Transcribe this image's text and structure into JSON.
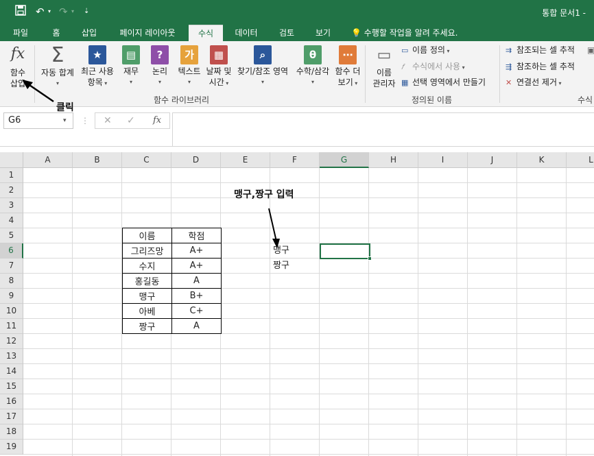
{
  "window": {
    "title": "통합 문서1 -"
  },
  "tabs": [
    {
      "label": "파일",
      "active": false
    },
    {
      "label": "홈",
      "active": false
    },
    {
      "label": "삽입",
      "active": false
    },
    {
      "label": "페이지 레이아웃",
      "active": false
    },
    {
      "label": "수식",
      "active": true
    },
    {
      "label": "데이터",
      "active": false
    },
    {
      "label": "검토",
      "active": false
    },
    {
      "label": "보기",
      "active": false
    }
  ],
  "tell_me": "수행할 작업을 알려 주세요.",
  "ribbon": {
    "insert_function": {
      "icon_text": "fx",
      "line1": "함수",
      "line2": "삽입"
    },
    "library": [
      {
        "line1": "자동 합계",
        "line2": "",
        "icon": "sigma-icon"
      },
      {
        "line1": "최근 사용",
        "line2": "항목",
        "icon": "star-book-icon"
      },
      {
        "line1": "재무",
        "line2": "",
        "icon": "finance-icon"
      },
      {
        "line1": "논리",
        "line2": "",
        "icon": "question-icon"
      },
      {
        "line1": "텍스트",
        "line2": "",
        "icon": "text-icon"
      },
      {
        "line1": "날짜 및",
        "line2": "시간",
        "icon": "calendar-icon"
      },
      {
        "line1": "찾기/참조 영역",
        "line2": "",
        "icon": "lookup-icon"
      },
      {
        "line1": "수학/삼각",
        "line2": "",
        "icon": "theta-icon"
      },
      {
        "line1": "함수 더",
        "line2": "보기",
        "icon": "more-functions-icon"
      }
    ],
    "library_group_label": "함수 라이브러리",
    "name_manager": {
      "line1": "이름",
      "line2": "관리자"
    },
    "defined_names": {
      "define": "이름 정의",
      "use_in_formula": "수식에서 사용",
      "create_from_selection": "선택 영역에서 만들기",
      "group_label": "정의된 이름"
    },
    "auditing": {
      "trace_precedents": "참조되는 셀 추적",
      "trace_dependents": "참조하는 셀 추적",
      "remove_arrows": "연결선 제거",
      "group_label": "수식"
    }
  },
  "formula_bar": {
    "name_box": "G6",
    "fx_label": "fx",
    "cancel": "✕",
    "enter": "✓",
    "dots": "⋮"
  },
  "columns": [
    "A",
    "B",
    "C",
    "D",
    "E",
    "F",
    "G",
    "H",
    "I",
    "J",
    "K",
    "L"
  ],
  "rows": [
    "1",
    "2",
    "3",
    "4",
    "5",
    "6",
    "7",
    "8",
    "9",
    "10",
    "11",
    "12",
    "13",
    "14",
    "15",
    "16",
    "17",
    "18",
    "19"
  ],
  "table": {
    "header": [
      "이름",
      "학점"
    ],
    "rows": [
      [
        "그리즈망",
        "A+"
      ],
      [
        "수지",
        "A+"
      ],
      [
        "홍길동",
        "A"
      ],
      [
        "맹구",
        "B+"
      ],
      [
        "아베",
        "C+"
      ],
      [
        "짱구",
        "A"
      ]
    ]
  },
  "cells": {
    "F6": "맹구",
    "F7": "짱구"
  },
  "annotations": {
    "input_note": "맹구,짱구 입력",
    "click_note": "클릭"
  }
}
